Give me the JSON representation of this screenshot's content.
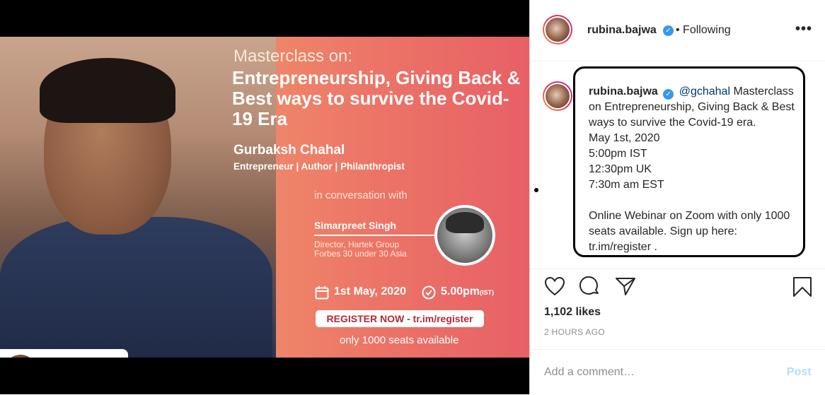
{
  "post_image": {
    "masterclass_label": "Masterclass on:",
    "headline": "Entrepreneurship, Giving Back & Best ways to survive the Covid-19 Era",
    "speaker_name": "Gurbaksh Chahal",
    "speaker_roles": "Entrepreneur | Author | Philanthropist",
    "conversation": "in conversation with",
    "guest_name": "Simarpreet Singh",
    "guest_role_1": "Director, Hartek Group",
    "guest_role_2": "Forbes 30 under 30 Asia",
    "date": "1st May, 2020",
    "time": "5.00pm",
    "time_zone": "(IST)",
    "register": "REGISTER NOW - tr.im/register",
    "seats": "only 1000 seats available",
    "tag_user": "gchahal"
  },
  "header": {
    "username": "rubina.bajwa",
    "follow_status": "• Following",
    "more": "•••"
  },
  "caption": {
    "username": "rubina.bajwa",
    "mention": "@gchahal",
    "text": " Masterclass on Entrepreneurship, Giving Back & Best ways to survive the Covid-19 era.",
    "details": "May 1st, 2020\n5:00pm IST\n12:30pm UK\n7:30m am EST\n\nOnline Webinar on Zoom with only 1000 seats available. Sign up here: tr.im/register ."
  },
  "stats": {
    "likes": "1,102 likes",
    "time_ago": "2 HOURS AGO"
  },
  "comment": {
    "placeholder": "Add a comment…",
    "post_label": "Post"
  },
  "colors": {
    "verified": "#3897f0",
    "mention": "#00376b",
    "post_disabled": "#b2dffc"
  }
}
